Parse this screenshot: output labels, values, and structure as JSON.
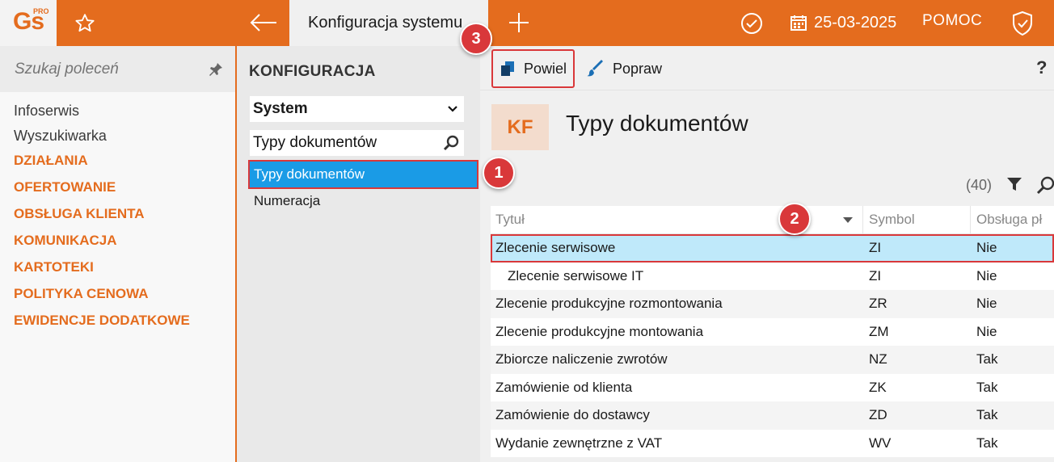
{
  "app": {
    "logo_text": "Gs",
    "logo_sup": "PRO",
    "active_tab": "Konfiguracja systemu",
    "date": "25-03-2025",
    "help": "POMOC"
  },
  "sidebar": {
    "search_placeholder": "Szukaj poleceń",
    "items": [
      {
        "label": "Infoserwis",
        "section": false
      },
      {
        "label": "Wyszukiwarka",
        "section": false
      },
      {
        "label": "DZIAŁANIA",
        "section": true
      },
      {
        "label": "OFERTOWANIE",
        "section": true
      },
      {
        "label": "OBSŁUGA KLIENTA",
        "section": true
      },
      {
        "label": "KOMUNIKACJA",
        "section": true
      },
      {
        "label": "KARTOTEKI",
        "section": true
      },
      {
        "label": "POLITYKA CENOWA",
        "section": true
      },
      {
        "label": "EWIDENCJE DODATKOWE",
        "section": true
      }
    ]
  },
  "config": {
    "title": "KONFIGURACJA",
    "select_value": "System",
    "search_value": "Typy dokumentów",
    "tree": [
      "Typy dokumentów",
      "Numeracja"
    ]
  },
  "toolbar": {
    "copy_label": "Powiel",
    "edit_label": "Popraw",
    "help": "?"
  },
  "main": {
    "badge": "KF",
    "title": "Typy dokumentów",
    "count": "(40)",
    "columns": {
      "title": "Tytuł",
      "symbol": "Symbol",
      "obs": "Obsługa pł"
    },
    "rows": [
      {
        "title": "Zlecenie serwisowe",
        "symbol": "ZI",
        "obs": "Nie"
      },
      {
        "title": "Zlecenie serwisowe IT",
        "symbol": "ZI",
        "obs": "Nie"
      },
      {
        "title": "Zlecenie produkcyjne rozmontowania",
        "symbol": "ZR",
        "obs": "Nie"
      },
      {
        "title": "Zlecenie produkcyjne montowania",
        "symbol": "ZM",
        "obs": "Nie"
      },
      {
        "title": "Zbiorcze naliczenie zwrotów",
        "symbol": "NZ",
        "obs": "Tak"
      },
      {
        "title": "Zamówienie od klienta",
        "symbol": "ZK",
        "obs": "Tak"
      },
      {
        "title": "Zamówienie do dostawcy",
        "symbol": "ZD",
        "obs": "Tak"
      },
      {
        "title": "Wydanie zewnętrzne z VAT",
        "symbol": "WV",
        "obs": "Tak"
      }
    ]
  },
  "callouts": [
    "1",
    "2",
    "3"
  ],
  "colors": {
    "brand": "#e46c1e",
    "selection_blue": "#1a9be6",
    "row_highlight": "#bfe9fa",
    "annotation_red": "#d9383a"
  }
}
